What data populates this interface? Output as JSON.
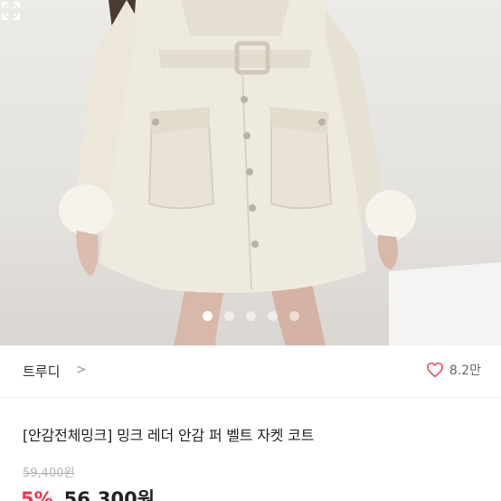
{
  "product_image": {
    "description_icon": "coat-photo",
    "pagination": {
      "total": 5,
      "active_index": 0
    },
    "expand_icon": "expand-icon"
  },
  "seller": {
    "name": "트루디",
    "chevron": ">",
    "likes": "8.2만"
  },
  "product": {
    "title": "[안감전체밍크] 밍크 레더 안감 퍼 벨트 자켓 코트",
    "original_price": "59,400원",
    "discount": "5%",
    "price": "56,300원"
  },
  "colors": {
    "accent": "#f0324b",
    "heart": "#e8546a"
  }
}
